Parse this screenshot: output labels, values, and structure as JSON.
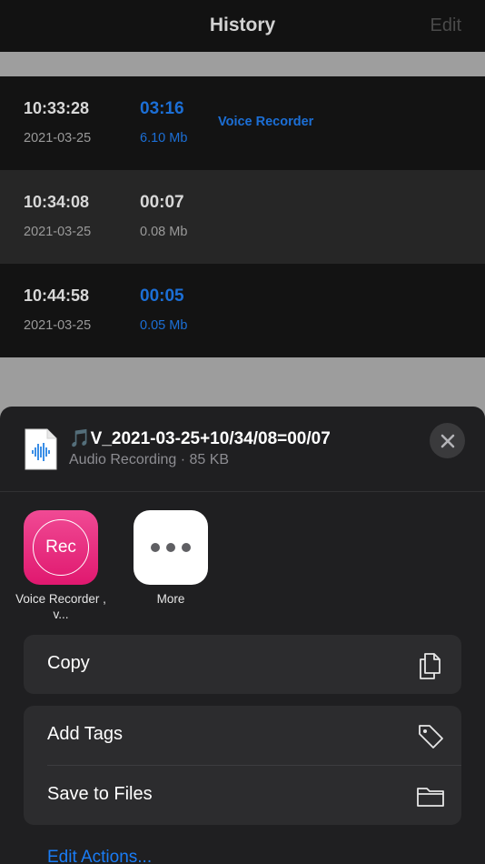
{
  "nav": {
    "title": "History",
    "edit": "Edit"
  },
  "recordings": [
    {
      "time": "10:33:28",
      "date": "2021-03-25",
      "duration": "03:16",
      "size": "6.10 Mb",
      "app": "Voice Recorder"
    },
    {
      "time": "10:34:08",
      "date": "2021-03-25",
      "duration": "00:07",
      "size": "0.08 Mb",
      "app": ""
    },
    {
      "time": "10:44:58",
      "date": "2021-03-25",
      "duration": "00:05",
      "size": "0.05 Mb",
      "app": ""
    }
  ],
  "share": {
    "file_name": "🎵V_2021-03-25+10/34/08=00/07",
    "file_meta": "Audio Recording · 85 KB",
    "apps": [
      {
        "label": "Voice Recorder , v...",
        "icon_text": "Rec",
        "icon": "rec-app-icon"
      },
      {
        "label": "More",
        "icon": "more-dots-icon"
      }
    ],
    "actions": {
      "copy": "Copy",
      "add_tags": "Add Tags",
      "save_to_files": "Save to Files"
    },
    "edit_actions": "Edit Actions..."
  },
  "colors": {
    "accent_blue": "#1c6fd6",
    "link_blue": "#1a7cf5",
    "rec_pink": "#e0186f"
  }
}
